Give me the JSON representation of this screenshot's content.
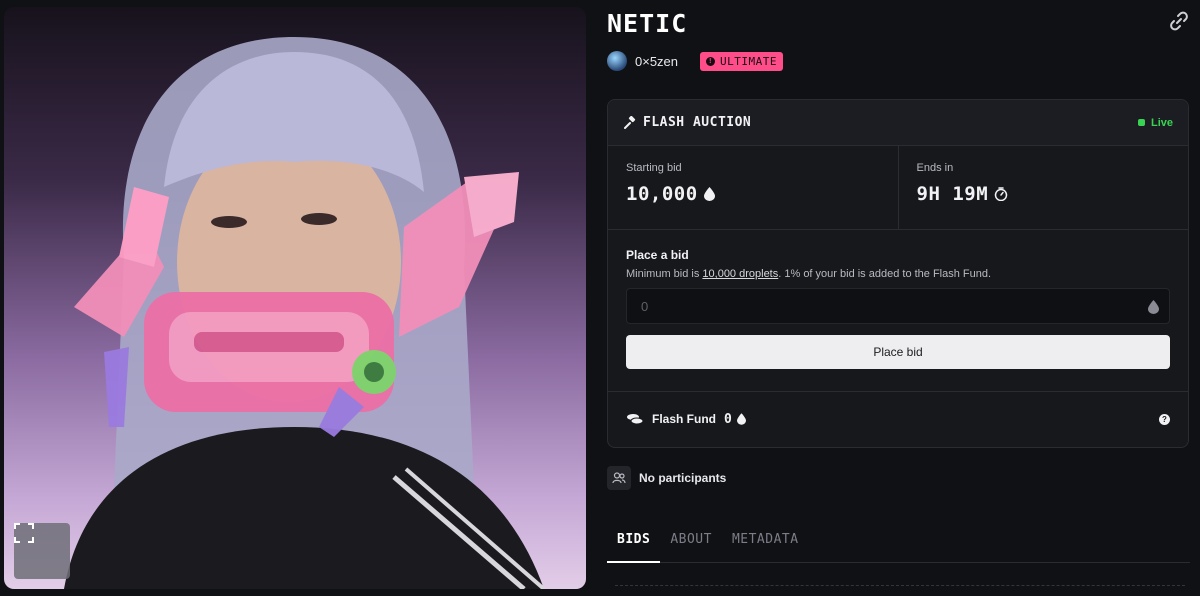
{
  "nft": {
    "title": "NETIC",
    "owner": "0×5zen",
    "rarity_badge": "ULTIMATE"
  },
  "icons": {
    "fullscreen": "fullscreen-icon",
    "link": "link-icon",
    "hammer": "gavel-icon",
    "droplet": "droplet-icon",
    "timer": "timer-icon",
    "coins": "coins-icon",
    "help": "help-icon",
    "participants": "users-icon"
  },
  "auction": {
    "header": "FLASH AUCTION",
    "status": "Live",
    "starting_bid_label": "Starting bid",
    "starting_bid_value": "10,000",
    "ends_in_label": "Ends in",
    "ends_in_value": "9H 19M",
    "place_bid_title": "Place a bid",
    "note_prefix": "Minimum bid is ",
    "note_link": "10,000 droplets",
    "note_suffix": ". 1% of your bid is added to the Flash Fund.",
    "input_placeholder": "0",
    "place_bid_button": "Place bid",
    "fund_label": "Flash Fund",
    "fund_value": "0",
    "help_glyph": "?"
  },
  "participants": {
    "text": "No participants"
  },
  "tabs": [
    {
      "label": "BIDS",
      "active": true
    },
    {
      "label": "ABOUT",
      "active": false
    },
    {
      "label": "METADATA",
      "active": false
    }
  ],
  "colors": {
    "accent_pink": "#ff4d8a",
    "live_green": "#39d353",
    "background": "#101114",
    "card": "#17181c"
  }
}
